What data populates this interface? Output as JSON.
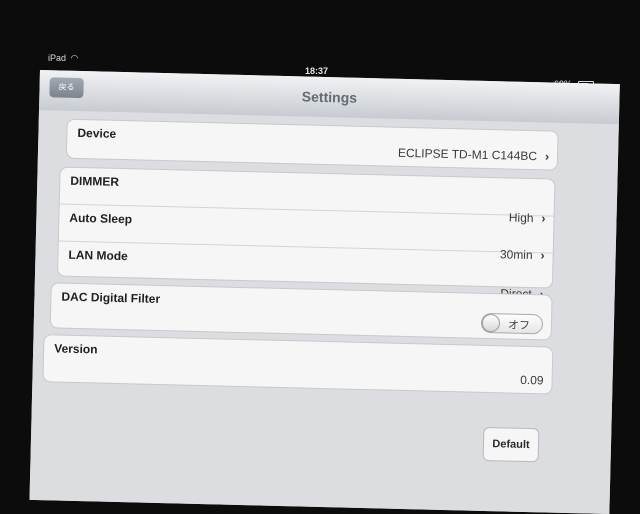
{
  "status": {
    "device": "iPad",
    "time": "18:37",
    "battery": "69%"
  },
  "navbar": {
    "back_label": "戻る",
    "title": "Settings"
  },
  "groups": {
    "device": {
      "label": "Device",
      "value": "ECLIPSE TD-M1 C144BC"
    },
    "dimmer": {
      "label": "DIMMER",
      "value": "High"
    },
    "auto_sleep": {
      "label": "Auto Sleep",
      "value": "30min"
    },
    "lan_mode": {
      "label": "LAN Mode",
      "value": "Direct"
    },
    "dac_filter": {
      "label": "DAC Digital Filter",
      "toggle_state": "オフ"
    },
    "version": {
      "label": "Version",
      "value": "0.09"
    }
  },
  "buttons": {
    "default_label": "Default"
  },
  "icons": {
    "wifi": "wifi-icon",
    "battery": "battery-icon",
    "chevron": "chevron-right-icon"
  }
}
